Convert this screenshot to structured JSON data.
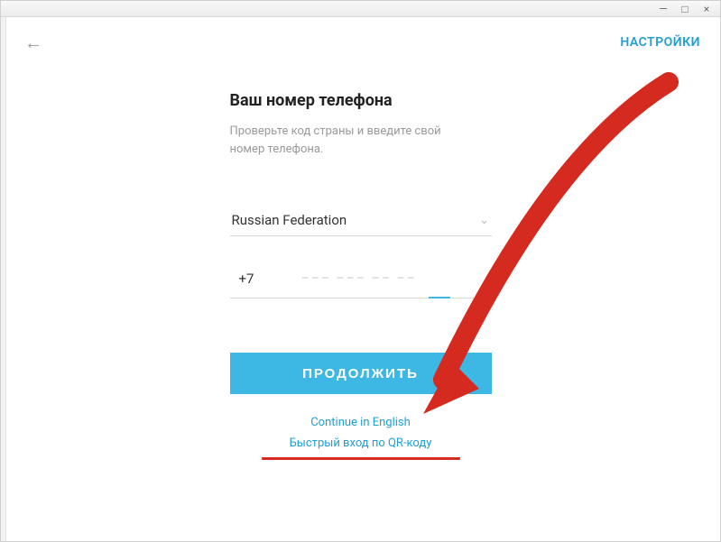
{
  "window": {
    "minimize": "—",
    "maximize": "□",
    "close": "×"
  },
  "header": {
    "back": "←",
    "settings": "НАСТРОЙКИ"
  },
  "form": {
    "title": "Ваш номер телефона",
    "subtitle": "Проверьте код страны и введите свой номер телефона.",
    "country": "Russian Federation",
    "chevron": "⌄",
    "dial_code": "+7",
    "phone_placeholder": "––– ––– –– ––",
    "continue_label": "ПРОДОЛЖИТЬ"
  },
  "links": {
    "english": "Continue in English",
    "qr": "Быстрый вход по QR-коду"
  },
  "annotation": {
    "color": "#d42a1f"
  }
}
